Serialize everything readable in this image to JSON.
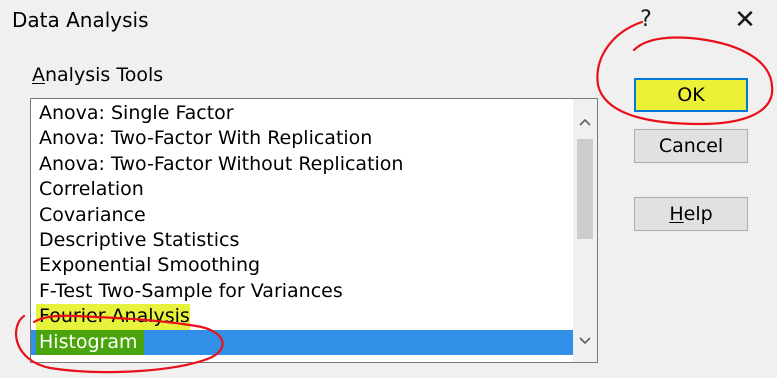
{
  "dialog": {
    "title": "Data Analysis",
    "help_glyph": "?",
    "close_glyph": "✕"
  },
  "analysis_tools": {
    "label_mnemonic": "A",
    "label_rest": "nalysis Tools",
    "items": [
      "Anova: Single Factor",
      "Anova: Two-Factor With Replication",
      "Anova: Two-Factor Without Replication",
      "Correlation",
      "Covariance",
      "Descriptive Statistics",
      "Exponential Smoothing",
      "F-Test Two-Sample for Variances",
      "Fourier Analysis",
      "Histogram"
    ],
    "selected": "Histogram"
  },
  "buttons": {
    "ok": "OK",
    "cancel": "Cancel",
    "help_mnemonic": "H",
    "help_rest": "elp"
  },
  "scrollbar": {
    "up_icon": "chevron-up",
    "down_icon": "chevron-down"
  },
  "colors": {
    "selection": "#3390e8",
    "ok_highlight": "#ecf036",
    "histogram_highlight": "#4aa40c",
    "annotation": "#e8101a"
  }
}
